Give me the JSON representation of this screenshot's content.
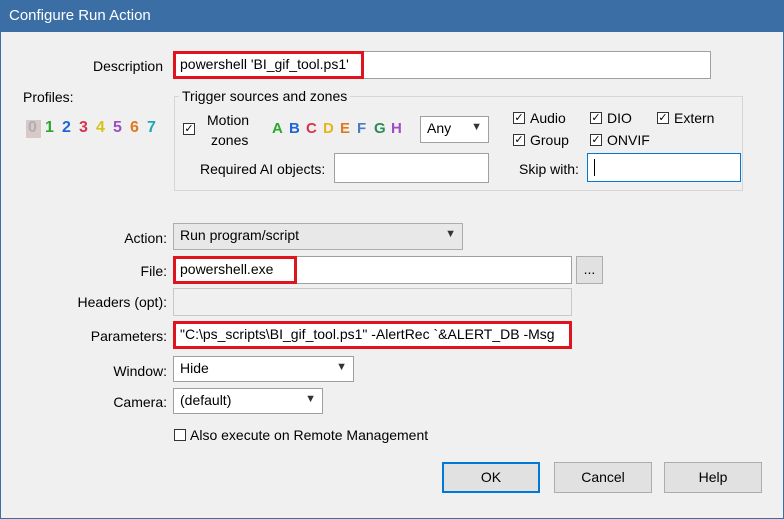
{
  "dialog": {
    "title": "Configure Run Action"
  },
  "description": {
    "label": "Description",
    "value": "powershell 'BI_gif_tool.ps1'"
  },
  "profiles": {
    "label": "Profiles:",
    "items": [
      {
        "text": "0",
        "color": "#b0b0b0"
      },
      {
        "text": "1",
        "color": "#2aa82a"
      },
      {
        "text": "2",
        "color": "#1e66d6"
      },
      {
        "text": "3",
        "color": "#d6334c"
      },
      {
        "text": "4",
        "color": "#d4c41a"
      },
      {
        "text": "5",
        "color": "#a04cc4"
      },
      {
        "text": "6",
        "color": "#e07a1e"
      },
      {
        "text": "7",
        "color": "#1ea6b6"
      }
    ]
  },
  "trigger": {
    "group_label": "Trigger sources and zones",
    "motion_label_1": "Motion",
    "motion_label_2": "zones",
    "motion_checked": true,
    "zones": [
      {
        "text": "A",
        "color": "#2aa82a"
      },
      {
        "text": "B",
        "color": "#1e66d6"
      },
      {
        "text": "C",
        "color": "#d6334c"
      },
      {
        "text": "D",
        "color": "#e8b41a"
      },
      {
        "text": "E",
        "color": "#e07a1e"
      },
      {
        "text": "F",
        "color": "#4c7ac4"
      },
      {
        "text": "G",
        "color": "#2a8c5a"
      },
      {
        "text": "H",
        "color": "#a04cc4"
      }
    ],
    "zone_mode": "Any",
    "sources": [
      {
        "label": "Audio",
        "checked": true
      },
      {
        "label": "DIO",
        "checked": true
      },
      {
        "label": "Extern",
        "checked": true
      },
      {
        "label": "Group",
        "checked": true
      },
      {
        "label": "ONVIF",
        "checked": true
      }
    ],
    "required_ai_label": "Required AI objects:",
    "required_ai_value": "",
    "skip_label": "Skip with:",
    "skip_value": ""
  },
  "action": {
    "label": "Action:",
    "value": "Run program/script"
  },
  "file": {
    "label": "File:",
    "value": "powershell.exe",
    "browse_label": "..."
  },
  "headers": {
    "label": "Headers (opt):",
    "value": ""
  },
  "parameters": {
    "label": "Parameters:",
    "value": "\"C:\\ps_scripts\\BI_gif_tool.ps1\" -AlertRec `&ALERT_DB -Msg"
  },
  "window": {
    "label": "Window:",
    "value": "Hide"
  },
  "camera": {
    "label": "Camera:",
    "value": "(default)"
  },
  "remote": {
    "label": "Also execute on Remote Management",
    "checked": false
  },
  "buttons": {
    "ok": "OK",
    "cancel": "Cancel",
    "help": "Help"
  },
  "colors": {
    "highlight": "#e0141e",
    "title_bar": "#3a6ea5",
    "default_button_border": "#0078d7"
  }
}
